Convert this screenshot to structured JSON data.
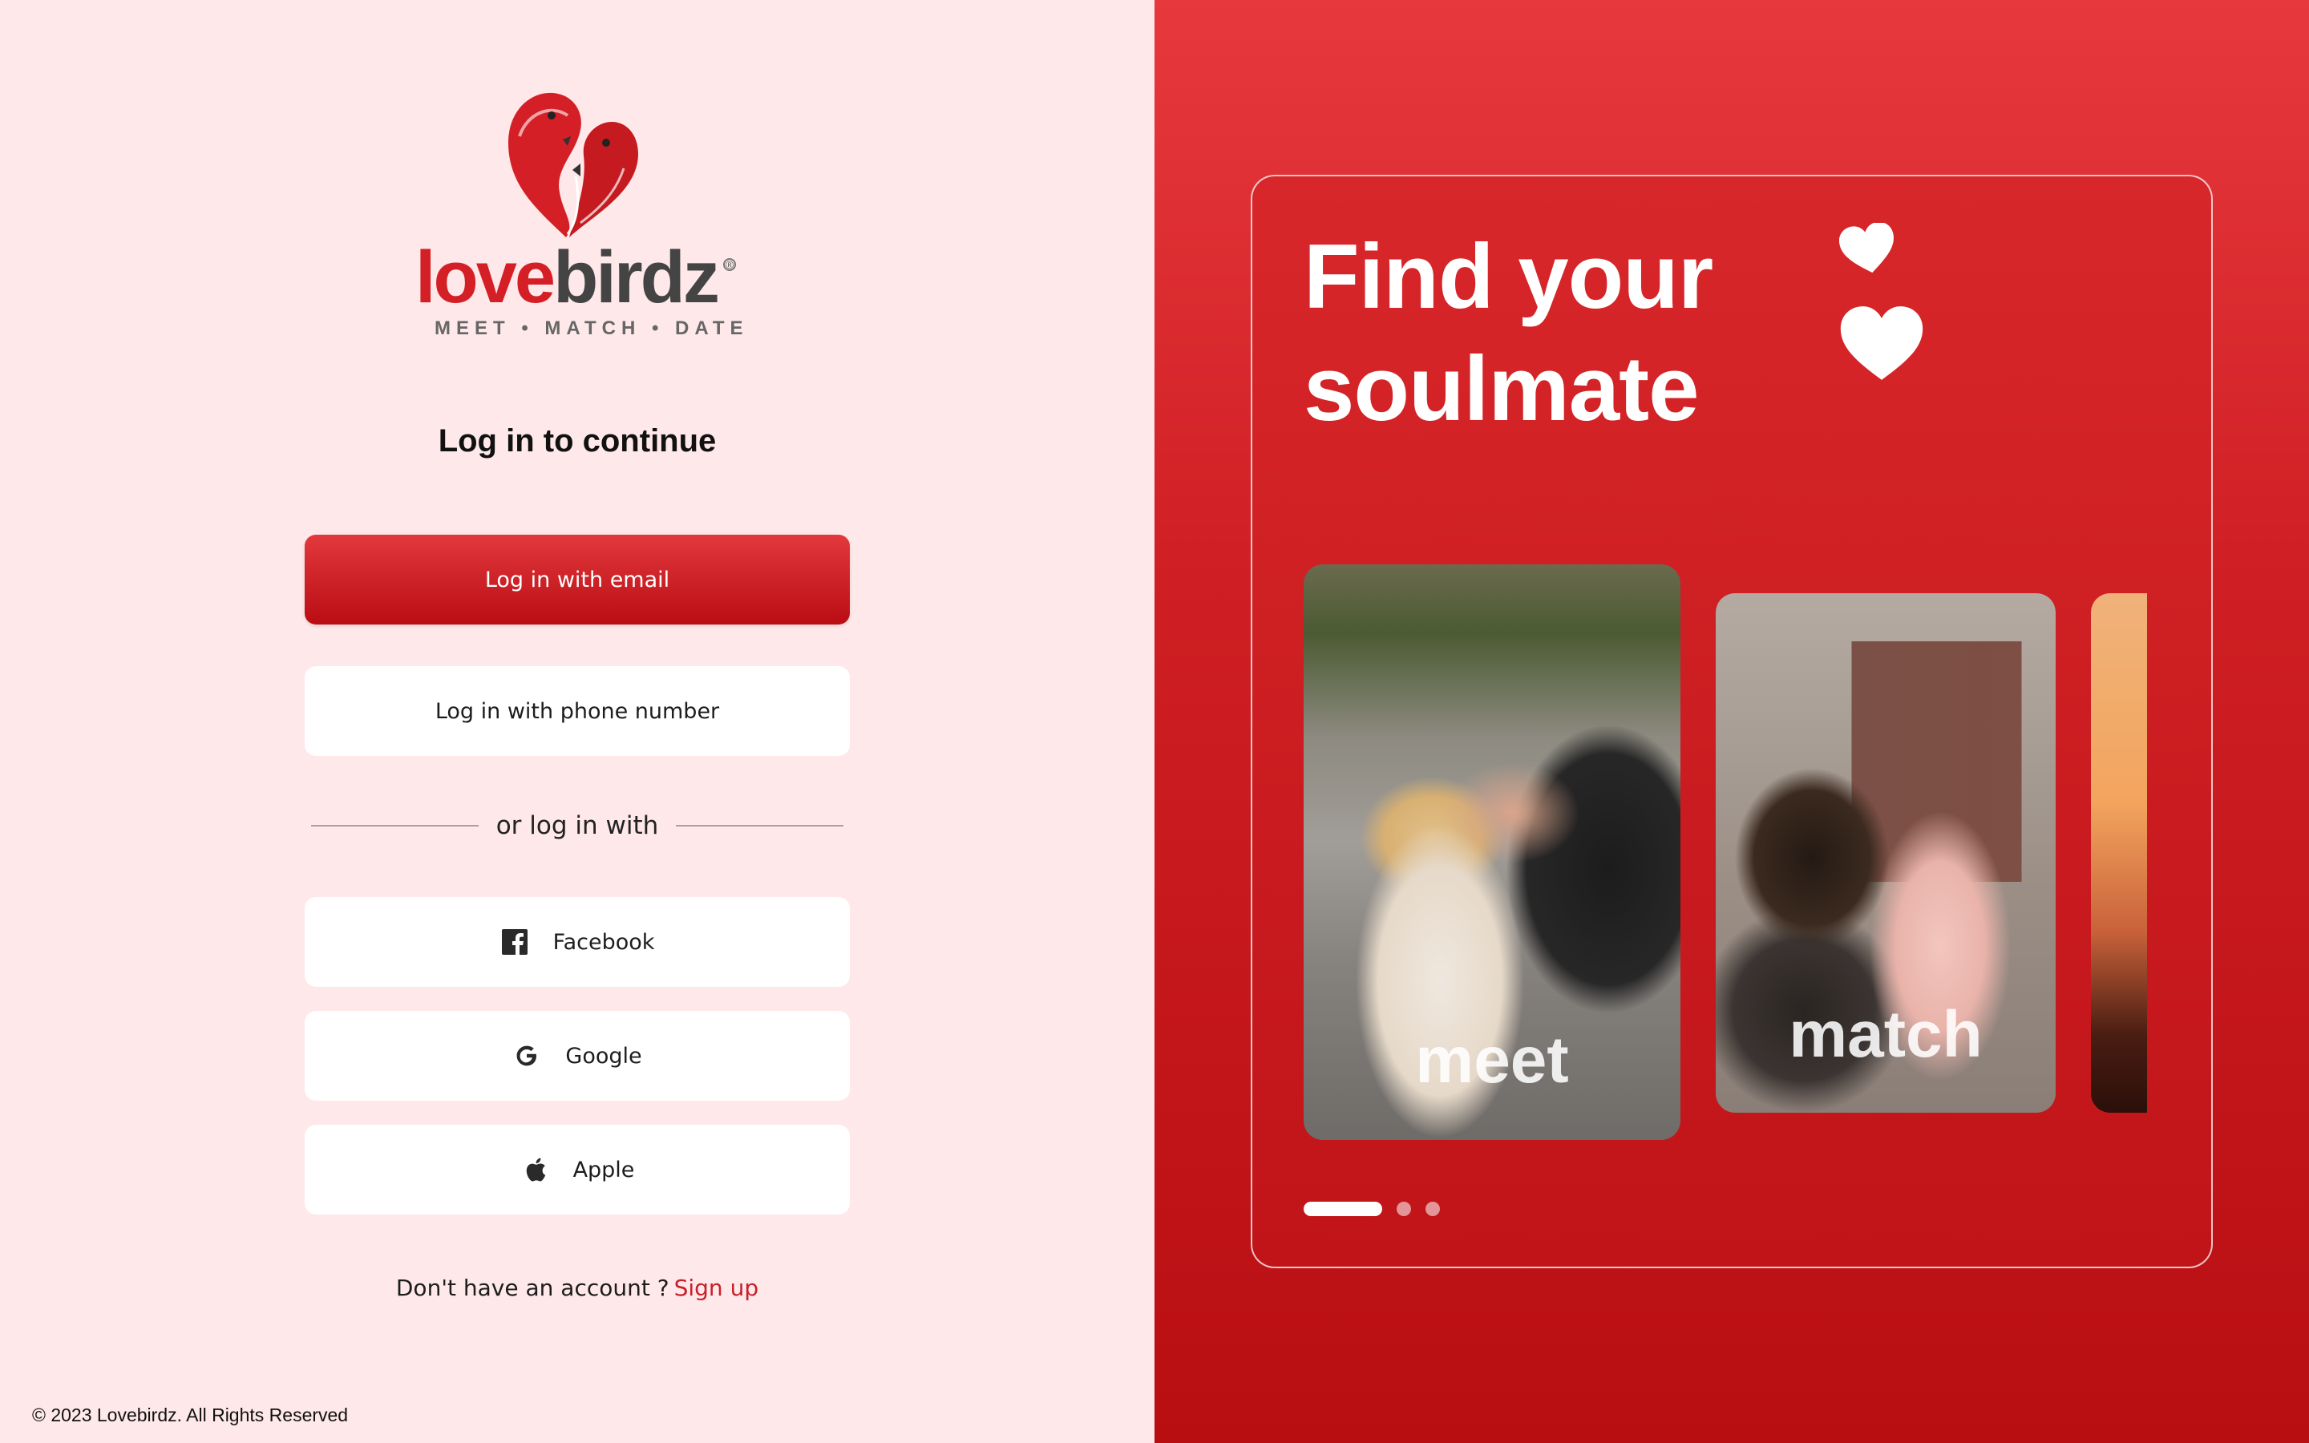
{
  "brand": {
    "name_part1": "love",
    "name_part2": "birdz",
    "registered": "®",
    "tagline": "MEET • MATCH • DATE",
    "colors": {
      "primary": "#d41f26",
      "dark": "#444444",
      "background_left": "#fee8e9"
    }
  },
  "login": {
    "title": "Log in to continue",
    "email_button": "Log in with email",
    "phone_button": "Log in with phone number",
    "divider_text": "or log in with",
    "social": [
      {
        "label": "Facebook",
        "icon": "facebook-icon"
      },
      {
        "label": "Google",
        "icon": "google-icon"
      },
      {
        "label": "Apple",
        "icon": "apple-icon"
      }
    ],
    "signup_prompt": "Don't have an account ?",
    "signup_link": "Sign up"
  },
  "footer": {
    "copyright": "© 2023 Lovebirdz. All Rights Reserved"
  },
  "promo": {
    "headline_line1": "Find your",
    "headline_line2": "soulmate",
    "icons": [
      "heart-icon",
      "heart-icon"
    ],
    "carousel": [
      {
        "label": "meet"
      },
      {
        "label": "match"
      },
      {
        "label": ""
      }
    ],
    "active_slide": 1,
    "slide_count": 3
  }
}
